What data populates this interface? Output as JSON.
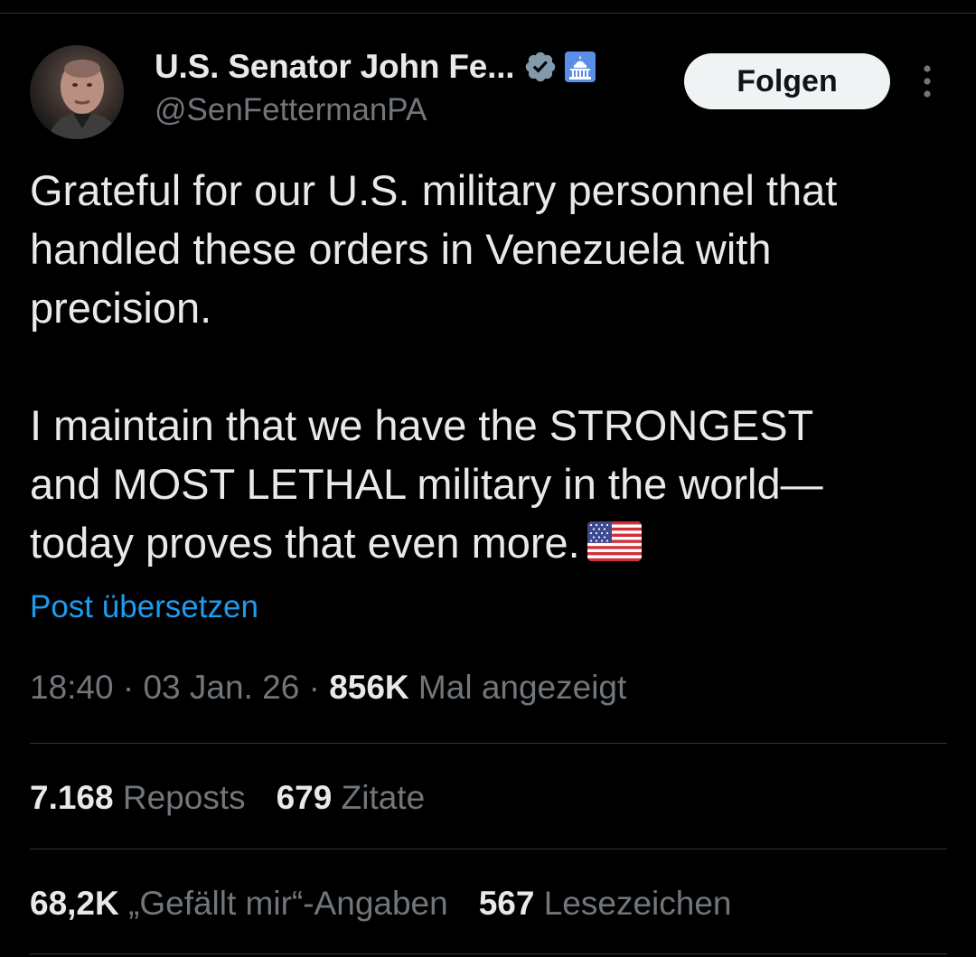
{
  "author": {
    "display_name": "U.S. Senator John Fe...",
    "handle": "@SenFettermanPA",
    "avatar_icon": "profile-photo",
    "verified_icon": "verified-badge-icon",
    "affiliation_icon": "capitol-building-icon"
  },
  "actions": {
    "follow_label": "Folgen",
    "more_icon": "more-vertical-icon"
  },
  "tweet": {
    "paragraph_1": "Grateful for our U.S. military personnel that handled these orders in Venezuela with precision.",
    "paragraph_2_line_1": "I maintain that we have the STRONGEST",
    "paragraph_2_line_2": "and MOST LETHAL military in the world—",
    "paragraph_2_line_3": "today proves that even more.",
    "emoji": "us-flag-emoji",
    "translate_label": "Post übersetzen"
  },
  "meta": {
    "time": "18:40",
    "separator": "·",
    "date": "03 Jan. 26",
    "views_count": "856K",
    "views_label": "Mal angezeigt"
  },
  "stats": {
    "reposts_count": "7.168",
    "reposts_label": "Reposts",
    "quotes_count": "679",
    "quotes_label": "Zitate",
    "likes_count": "68,2K",
    "likes_label": "„Gefällt mir“-Angaben",
    "bookmarks_count": "567",
    "bookmarks_label": "Lesezeichen"
  },
  "colors": {
    "background": "#000000",
    "text": "#e7e9ea",
    "secondary_text": "#71767b",
    "link": "#1d9bf0",
    "divider": "#2f3336",
    "verified": "#829aab",
    "follow_button_bg": "#eff3f4"
  }
}
